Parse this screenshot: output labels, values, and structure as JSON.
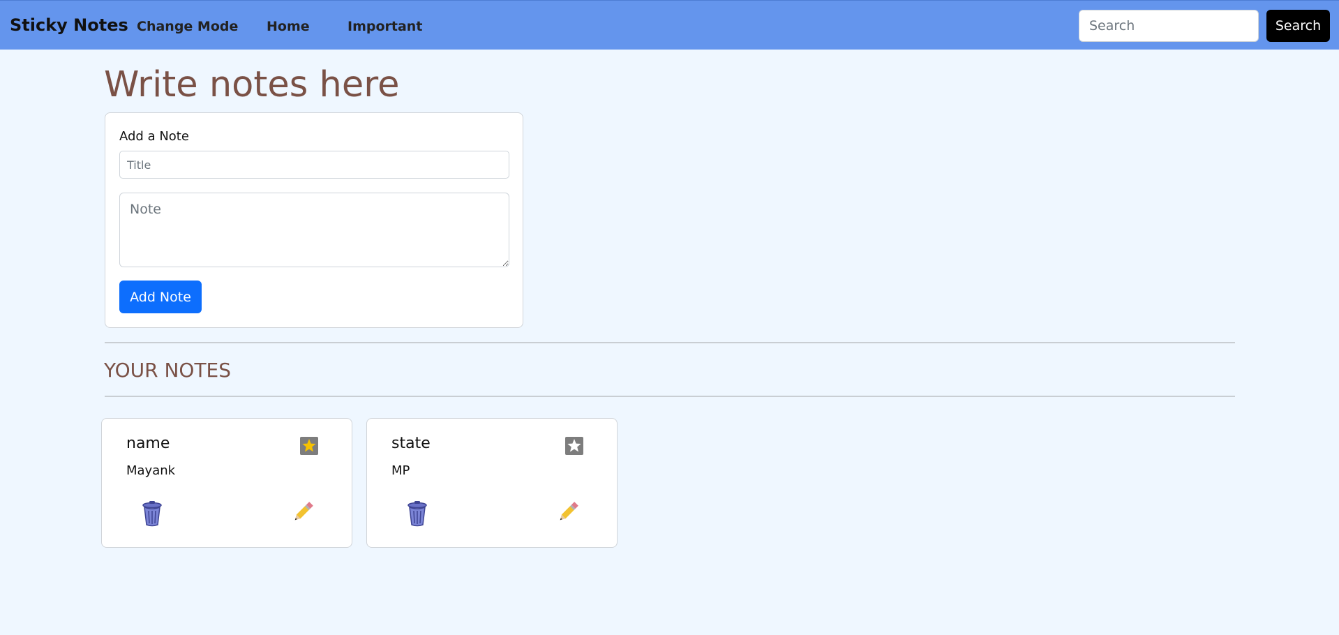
{
  "nav": {
    "brand": "Sticky Notes",
    "links": [
      "Change Mode",
      "Home",
      "Important"
    ],
    "search_placeholder": "Search",
    "search_button": "Search"
  },
  "main": {
    "heading": "Write notes here",
    "form": {
      "label": "Add a Note",
      "title_placeholder": "Title",
      "note_placeholder": "Note",
      "add_button": "Add Note"
    },
    "notes_heading": "YOUR NOTES",
    "notes": [
      {
        "title": "name",
        "body": "Mayank",
        "important": true
      },
      {
        "title": "state",
        "body": "MP",
        "important": false
      }
    ]
  },
  "colors": {
    "navbar": "#6495ed",
    "page_bg": "#eff7ff",
    "heading": "#7a5146",
    "primary_button": "#0d6efd",
    "search_button": "#000000"
  },
  "icons": [
    "star-icon",
    "trash-icon",
    "pencil-icon"
  ]
}
